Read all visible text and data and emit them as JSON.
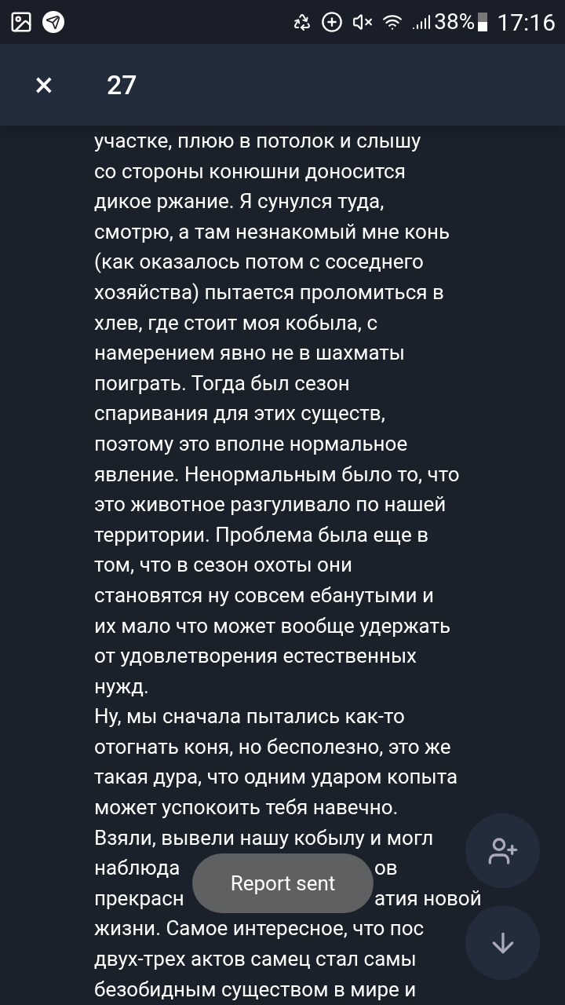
{
  "status_bar": {
    "battery": "38%",
    "time": "17:16"
  },
  "header": {
    "close": "×",
    "title": "27"
  },
  "message_lines": [
    "участке, плюю в потолок и слышу",
    "со стороны конюшни доносится",
    "дикое ржание. Я сунулся туда,",
    "смотрю, а там незнакомый мне конь",
    "(как оказалось потом с соседнего",
    "хозяйства) пытается проломиться в",
    "хлев, где стоит моя кобыла, с",
    "намерением явно не в шахматы",
    "поиграть. Тогда был сезон",
    "спаривания для этих существ,",
    "поэтому это вполне нормальное",
    "явление. Ненормальным было то, что",
    "это животное разгуливало по нашей",
    "территории. Проблема была еще в",
    "том, что в сезон охоты они",
    "становятся ну совсем ебанутыми и",
    "их мало что может вообще удержать",
    "от удовлетворения естественных",
    "нужд.",
    "Ну, мы сначала пытались как-то",
    "отогнать коня, но бесполезно, это же",
    "такая дура, что одним ударом копыта",
    "может успокоить тебя навечно.",
    "Взяли, вывели нашу кобылу и могл",
    [
      "наблюда",
      "ов"
    ],
    [
      "прекрасн",
      "атия новой"
    ],
    "жизни. Самое интересное, что пос",
    "двух-трех актов самец стал самы",
    "безобидным существом в мире и"
  ],
  "toast": "Report sent"
}
